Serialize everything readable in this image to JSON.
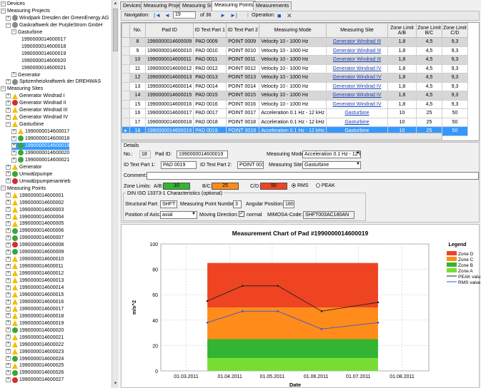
{
  "tree": {
    "devices": "Devices",
    "measuring_projects": "Measuring Projects",
    "windpark": "Windpark Dresden der GreenEnergy AG",
    "gaskraftwerk": "Gaskraftwerk der PurpleStrom GmbH",
    "gasturbine": "Gasturbine",
    "gt_points": [
      "1990000014600017",
      "1990000014600018",
      "1990000014600019",
      "1990000014600020",
      "1990000014600021"
    ],
    "generator": "Generator",
    "spitzen": "Spitzenheizkraftwerk der DREHWAS",
    "measuring_sites": "Measuring Sites",
    "sites": [
      "Generator Windrad I",
      "Generator Windrad II",
      "Generator Windrad III",
      "Generator Windrad IV"
    ],
    "ms_gasturbine": "Gasturbine",
    "ms_gt_points": [
      "1990000014600017",
      "1990000014600018",
      "1990000014600019",
      "1990000014600020",
      "1990000014600021"
    ],
    "ms_generator": "Generator",
    "umwaelz": "Umwälzpumpe",
    "umwaelzantrieb": "Umwälzpumpenantrieb",
    "measuring_points": "Measuring Points",
    "points": [
      "1990000014600001",
      "1990000014600002",
      "1990000014600003",
      "1990000014600004",
      "1990000014600005",
      "1990000014600006",
      "1990000014600007",
      "1990000014600008",
      "1990000014600009",
      "1990000014600010",
      "1990000014600011",
      "1990000014600012",
      "1990000014600013",
      "1990000014600014",
      "1990000014600015",
      "1990000014600016",
      "1990000014600017",
      "1990000014600018",
      "1990000014600019",
      "1990000014600020",
      "1990000014600021",
      "1990000014600022",
      "1990000014600023",
      "1990000014600024",
      "1990000014600025",
      "1990000014600026",
      "1990000014600027"
    ],
    "point_status": [
      "warn",
      "warn",
      "warn",
      "warn",
      "warn",
      "ok",
      "ok",
      "err",
      "ok",
      "warn",
      "warn",
      "warn",
      "warn",
      "warn",
      "warn",
      "warn",
      "warn",
      "warn",
      "warn",
      "ok",
      "warn",
      "warn",
      "warn",
      "ok",
      "warn",
      "ok",
      "err"
    ]
  },
  "tabs": [
    "Devices",
    "Measuring Projects",
    "Measuring Sites",
    "Measuring Points",
    "Measurements"
  ],
  "active_tab": 3,
  "nav": {
    "label": "Navigation:",
    "current": "19",
    "of": "of 36",
    "operation": "Operation:"
  },
  "grid": {
    "headers": [
      "No.",
      "Pad ID",
      "ID Text Part 1",
      "ID Text Part 2",
      "Measuring Mode",
      "Measuring Site",
      "Zone Limit A/B",
      "Zone Limit B/C",
      "Zone Limit C/D"
    ],
    "rows": [
      [
        "8",
        "1990000014600009",
        "PAD  0009",
        "POINT 0009",
        "Velocity 10 - 1000 Hz",
        "Generator Windrad III",
        "1,8",
        "4,5",
        "9,3"
      ],
      [
        "9",
        "1990000014600010",
        "PAD  0010",
        "POINT 0010",
        "Velocity 10 - 1000 Hz",
        "Generator Windrad III",
        "1,8",
        "4,5",
        "9,3"
      ],
      [
        "10",
        "1990000014600011",
        "PAD  0011",
        "POINT 0011",
        "Velocity 10 - 1000 Hz",
        "Generator Windrad III",
        "1,8",
        "4,5",
        "9,3"
      ],
      [
        "11",
        "1990000014600012",
        "PAD  0012",
        "POINT 0012",
        "Velocity 10 - 1000 Hz",
        "Generator Windrad IV",
        "1,8",
        "4,5",
        "9,3"
      ],
      [
        "12",
        "1990000014600013",
        "PAD  0013",
        "POINT 0013",
        "Velocity 10 - 1000 Hz",
        "Generator Windrad IV",
        "1,8",
        "4,5",
        "9,3"
      ],
      [
        "13",
        "1990000014600014",
        "PAD  0014",
        "POINT 0014",
        "Velocity 10 - 1000 Hz",
        "Generator Windrad IV",
        "1,8",
        "4,5",
        "9,3"
      ],
      [
        "14",
        "1990000014600015",
        "PAD  0015",
        "POINT 0015",
        "Velocity 10 - 1000 Hz",
        "Generator Windrad IV",
        "1,8",
        "4,5",
        "9,3"
      ],
      [
        "15",
        "1990000014600016",
        "PAD  0016",
        "POINT 0016",
        "Velocity 10 - 1000 Hz",
        "Generator Windrad IV",
        "1,8",
        "4,5",
        "9,3"
      ],
      [
        "16",
        "1990000014600017",
        "PAD  0017",
        "POINT 0017",
        "Acceleration 0.1 Hz - 12 kHz",
        "Gasturbine",
        "10",
        "25",
        "50"
      ],
      [
        "17",
        "1990000014600018",
        "PAD  0018",
        "POINT 0018",
        "Acceleration 0.1 Hz - 12 kHz",
        "Gasturbine",
        "10",
        "25",
        "50"
      ],
      [
        "18",
        "1990000014600019",
        "PAD  0019",
        "POINT 0019",
        "Acceleration 0.1 Hz - 12 kHz",
        "Gasturbine",
        "10",
        "25",
        "50"
      ]
    ],
    "row_style": [
      "g",
      "w",
      "g",
      "w",
      "g",
      "w",
      "g",
      "w",
      "w",
      "w",
      "s"
    ]
  },
  "details": {
    "title": "Details",
    "no_label": "No.:",
    "no": "18",
    "padid_label": "Pad ID:",
    "padid": "1990000014600019",
    "mode_label": "Measuring Mode:",
    "mode": "Acceleration 0.1 Hz - 12 kHz",
    "id1_label": "ID Text Part 1:",
    "id1": "PAD  0019",
    "id2_label": "ID Text Part 2:",
    "id2": "POINT 0019",
    "site_label": "Measuring Site:",
    "site": "Gasturbine",
    "comment_label": "Comment:",
    "zone_label": "Zone Limits:",
    "ab_label": "A/B:",
    "ab": "10",
    "bc_label": "B/C:",
    "bc": "25",
    "cd_label": "C/D:",
    "cd": "50",
    "rms": "RMS",
    "peak": "PEAK",
    "din_title": "DIN ISO 13373-1 Characteristics (optional)",
    "struct_label": "Structural Part:",
    "struct": "SHFT",
    "mpn_label": "Measuring Point Number:",
    "mpn": "3",
    "ang_label": "Angular Position:",
    "ang": "180",
    "axis_label": "Position of Axis:",
    "axis": "axial",
    "move_label": "Moving Direction:",
    "normal": "normal",
    "mimosa_label": "MIMOSA-Code:",
    "mimosa": "SHFT003AC180AN"
  },
  "colors": {
    "zoneA": "#77dd33",
    "zoneB": "#33b533",
    "zoneC": "#ff8c1a",
    "zoneD": "#ee4422",
    "selected": "#3399ff"
  },
  "chart_data": {
    "type": "line",
    "title": "Measurement Chart of Pad #1990000014600019",
    "xlabel": "Date",
    "ylabel": "m/s^2",
    "ylim": [
      0,
      100
    ],
    "yticks": [
      0,
      20,
      40,
      60,
      80,
      100
    ],
    "xticks": [
      "01.03.2011",
      "01.04.2011",
      "01.05.2011",
      "01.06.2011",
      "01.07.2011",
      "01.08.2011"
    ],
    "xlim": [
      "2011-02-11",
      "2011-08-20"
    ],
    "zones": [
      {
        "name": "Zone D",
        "from": 50,
        "to": 85,
        "color": "#ee4422"
      },
      {
        "name": "Zone C",
        "from": 25,
        "to": 50,
        "color": "#ff8c1a"
      },
      {
        "name": "Zone B",
        "from": 10,
        "to": 25,
        "color": "#33b533"
      },
      {
        "name": "Zone A",
        "from": 0,
        "to": 10,
        "color": "#77dd33"
      }
    ],
    "zone_x": [
      "2011-03-16",
      "2011-07-15"
    ],
    "series": [
      {
        "name": "PEAK value",
        "color": "#222222",
        "x": [
          "2011-03-16",
          "2011-04-10",
          "2011-05-05",
          "2011-06-05",
          "2011-07-15"
        ],
        "y": [
          55,
          67,
          67,
          47,
          54
        ]
      },
      {
        "name": "RMS value",
        "color": "#3355dd",
        "x": [
          "2011-03-16",
          "2011-04-10",
          "2011-05-05",
          "2011-06-05",
          "2011-07-15"
        ],
        "y": [
          38,
          47,
          47,
          33,
          38
        ]
      }
    ],
    "legend_title": "Legend",
    "legend": "right",
    "grid": true
  }
}
